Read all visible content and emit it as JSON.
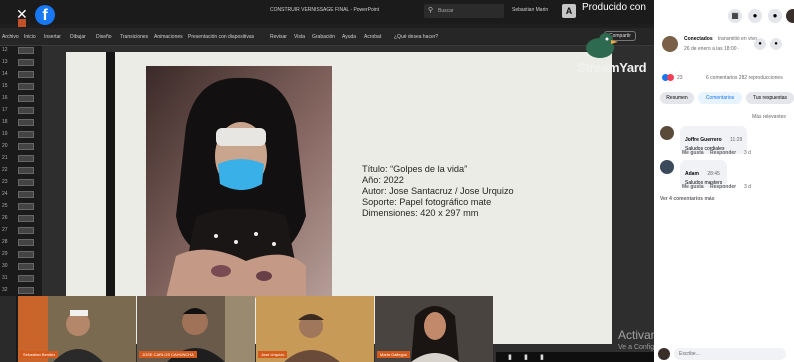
{
  "powerpoint": {
    "window_title": "CONSTRUIR VERNISSAGE FINAL - PowerPoint",
    "search_placeholder": "Buscar",
    "user_name": "Sebastian Marin",
    "user_initial": "A",
    "recording_label": "Producido con",
    "ribbon_tabs": [
      "Archivo",
      "Inicio",
      "Insertar",
      "Dibujar",
      "Diseño",
      "Transiciones",
      "Animaciones",
      "Presentación con diapositivas",
      "Revisar",
      "Vista",
      "Grabación",
      "Ayuda",
      "Acrobat",
      "¿Qué desea hacer?"
    ],
    "share_label": "Compartir",
    "slide_numbers": [
      "12",
      "13",
      "14",
      "15",
      "16",
      "17",
      "18",
      "19",
      "20",
      "21",
      "22",
      "23",
      "24",
      "25",
      "26",
      "27",
      "28",
      "29",
      "30",
      "31",
      "32"
    ],
    "slide_caption": {
      "title": "Título: “Golpes de la vida”",
      "year": "Año: 2022",
      "author": "Autor: Jose Santacruz / Jose Urquizo",
      "support": "Soporte: Papel fotográfico mate",
      "dimensions": "Dimensiones: 420 x 297 mm"
    },
    "streamyard_label": "StreamYard",
    "participants": [
      {
        "name": "Sebastian Benitez"
      },
      {
        "name": "JOSE CARLOS CAHUNCHA"
      },
      {
        "name": "Jose Urquizo"
      },
      {
        "name": "Maria Gallegos"
      }
    ],
    "activate_title": "Activar Windows",
    "activate_sub": "Ve a Configuración para activar Windows."
  },
  "facebook": {
    "page_name": "Conectados",
    "live_text": "transmitió en vivo.",
    "post_date": "26 de enero a las 18:00 ·",
    "reactions_count": "23",
    "stats": "6 comentarios  282 reproducciones",
    "tabs": [
      "Resumen",
      "Comentarios",
      "Tus respuestas"
    ],
    "sort_label": "Más relevantes",
    "comments": [
      {
        "author": "Joffre Guerrero",
        "time": "11:29",
        "text": "Saludos cordiales",
        "like": "Me gusta",
        "reply": "Responder",
        "age": "3 d"
      },
      {
        "author": "Adam",
        "time": "28:45",
        "text": "Saludos masters",
        "like": "Me gusta",
        "reply": "Responder",
        "age": "3 d"
      }
    ],
    "more_comments": "Ver 4 comentarios más",
    "write_label": "Escribe..."
  },
  "colors": {
    "fb_blue": "#1877f2",
    "slide_bg": "#ecece6",
    "nametag": "#d45a1c"
  }
}
